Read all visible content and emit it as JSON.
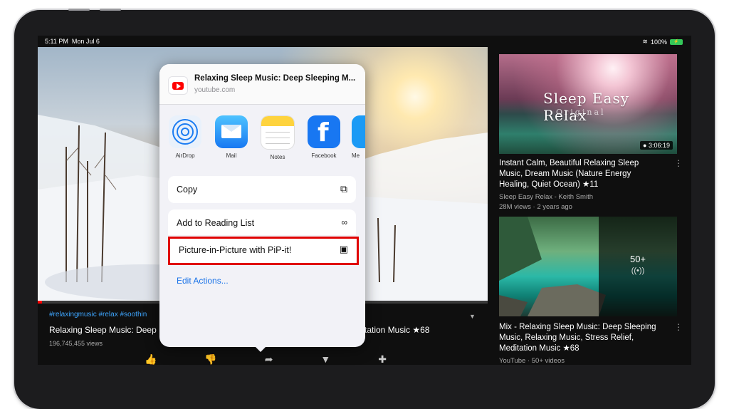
{
  "status": {
    "time": "5:11 PM",
    "date": "Mon Jul 6",
    "battery": "100%"
  },
  "video": {
    "hashtags": "#relaxingmusic #relax #soothin",
    "title_left": "Relaxing Sleep Music: Deep",
    "title_right": "tation Music ★68",
    "views": "196,745,455 views"
  },
  "share_sheet": {
    "title": "Relaxing Sleep Music: Deep Sleeping M...",
    "url": "youtube.com",
    "apps": [
      {
        "label": "AirDrop",
        "icon": "airdrop-icon"
      },
      {
        "label": "Mail",
        "icon": "mail-icon"
      },
      {
        "label": "Notes",
        "icon": "notes-icon"
      },
      {
        "label": "Facebook",
        "icon": "facebook-icon"
      },
      {
        "label": "Me",
        "icon": "messenger-icon"
      }
    ],
    "actions": [
      {
        "label": "Copy",
        "icon": "copy-icon"
      },
      {
        "label": "Add to Reading List",
        "icon": "glasses-icon"
      },
      {
        "label": "Picture-in-Picture with PiP-it!",
        "icon": "pip-icon"
      }
    ],
    "edit_actions": "Edit Actions..."
  },
  "sidebar": {
    "cards": [
      {
        "thumb_text": "Sleep Easy Relax",
        "thumb_subtext": "Original",
        "duration": "3:06:19",
        "title": "Instant Calm, Beautiful Relaxing Sleep Music, Dream Music (Nature Energy Healing, Quiet Ocean) ★11",
        "channel": "Sleep Easy Relax - Keith Smith",
        "meta": "28M views · 2 years ago"
      },
      {
        "mix_count": "50+",
        "title": "Mix - Relaxing Sleep Music: Deep Sleeping Music, Relaxing Music, Stress Relief, Meditation Music ★68",
        "channel": "YouTube · 50+ videos"
      }
    ]
  }
}
